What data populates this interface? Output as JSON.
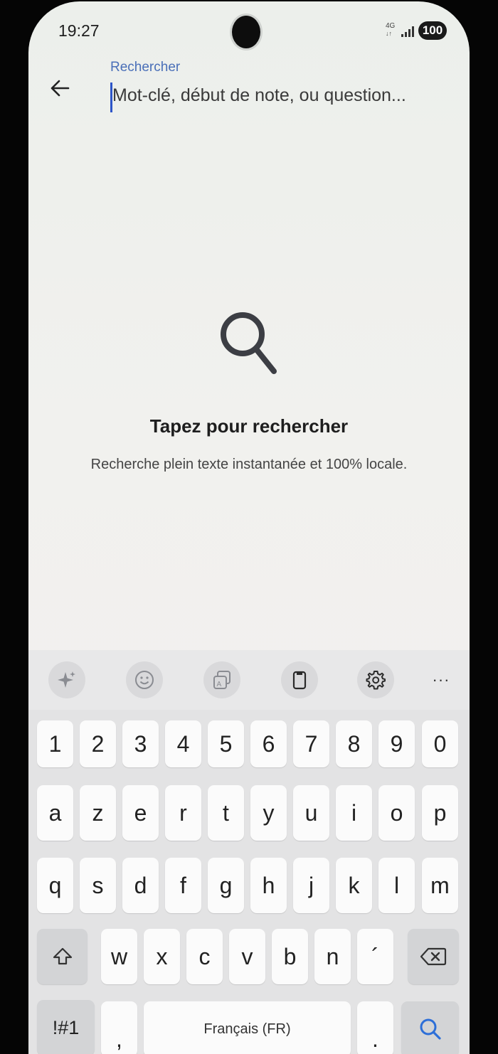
{
  "status_bar": {
    "time": "19:27",
    "network": "4G",
    "battery": "100"
  },
  "search": {
    "label": "Rechercher",
    "placeholder": "Mot-clé, début de note, ou question...",
    "value": ""
  },
  "empty_state": {
    "title": "Tapez pour rechercher",
    "subtitle": "Recherche plein texte instantanée et 100% locale."
  },
  "keyboard": {
    "toolbar": [
      "ai-sparkle-icon",
      "emoji-icon",
      "translate-icon",
      "clipboard-icon",
      "settings-icon",
      "more-icon"
    ],
    "more_label": "···",
    "row_numbers": [
      "1",
      "2",
      "3",
      "4",
      "5",
      "6",
      "7",
      "8",
      "9",
      "0"
    ],
    "row1": [
      "a",
      "z",
      "e",
      "r",
      "t",
      "y",
      "u",
      "i",
      "o",
      "p"
    ],
    "row2": [
      "q",
      "s",
      "d",
      "f",
      "g",
      "h",
      "j",
      "k",
      "l",
      "m"
    ],
    "row3": [
      "w",
      "x",
      "c",
      "v",
      "b",
      "n",
      "´"
    ],
    "symbols_label": "!#1",
    "comma_label": ",",
    "space_label": "Français (FR)",
    "period_label": "."
  },
  "colors": {
    "accent": "#2d55c8",
    "label_blue": "#4a6fb8"
  }
}
